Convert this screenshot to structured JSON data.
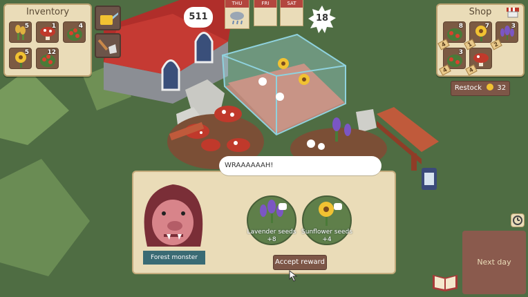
{
  "inventory": {
    "title": "Inventory",
    "items": [
      {
        "icon": "wheat-icon",
        "count": "5"
      },
      {
        "icon": "mushroom-icon",
        "count": "1"
      },
      {
        "icon": "tomato-plant-icon",
        "count": "4"
      },
      {
        "icon": "sunflower-icon",
        "count": "5"
      },
      {
        "icon": "tomato-plant-icon",
        "count": "12"
      }
    ]
  },
  "calendar": {
    "coins": "511",
    "days": [
      {
        "name": "THU",
        "weather": "rain-icon"
      },
      {
        "name": "FRI",
        "weather": ""
      },
      {
        "name": "SAT",
        "weather": ""
      }
    ],
    "badge": "18"
  },
  "shop": {
    "title": "Shop",
    "items": [
      {
        "icon": "tomato-plant-icon",
        "count": "8",
        "price": "4"
      },
      {
        "icon": "sunflower-icon",
        "count": "7",
        "price": "1"
      },
      {
        "icon": "lavender-icon",
        "count": "3",
        "price": "2"
      },
      {
        "icon": "tomato-plant-icon",
        "count": "3",
        "price": "4"
      },
      {
        "icon": "mushroom-icon",
        "count": "",
        "price": "4"
      }
    ],
    "restock_label": "Restock",
    "restock_cost": "32"
  },
  "dialog": {
    "speech": "WRAAAAAAH!",
    "character_name": "Forest monster",
    "rewards": [
      {
        "label": "Lavender seeds",
        "amount": "+8"
      },
      {
        "label": "Sunflower seeds",
        "amount": "+4"
      }
    ],
    "accept_label": "Accept reward"
  },
  "next_day_label": "Next day",
  "colors": {
    "grass": "#4f6d43",
    "panel": "#eadcb8",
    "accent": "#7d5647",
    "calendar_red": "#b3463e"
  }
}
